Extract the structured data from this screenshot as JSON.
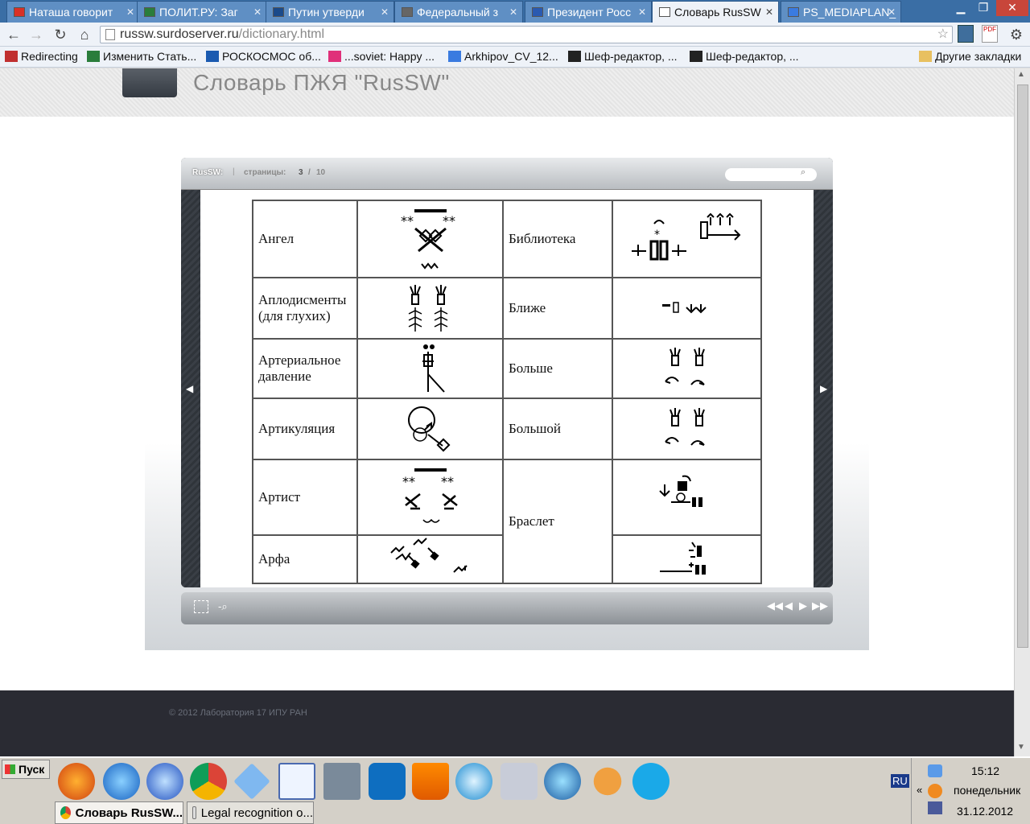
{
  "browser": {
    "tabs": [
      {
        "title": "Наташа говорит",
        "icon": "gmail-icon",
        "color": "#d93025"
      },
      {
        "title": "ПОЛИТ.РУ: Заг",
        "icon": "eye-icon",
        "color": "#2a7d3b"
      },
      {
        "title": "Путин утверди",
        "icon": "globe-icon",
        "color": "#1a4a8a"
      },
      {
        "title": "Федеральный з",
        "icon": "image-icon",
        "color": "#666"
      },
      {
        "title": "Президент Росс",
        "icon": "flag-icon",
        "color": "#2a5ab0"
      },
      {
        "title": "Словарь RusSW",
        "icon": "page-icon",
        "color": "#ffffff",
        "active": true
      },
      {
        "title": "PS_MEDIAPLAN_",
        "icon": "doc-icon",
        "color": "#3a7be0"
      }
    ],
    "url_host": "russw.surdoserver.ru",
    "url_path": "/dictionary.html",
    "bookmarks": [
      {
        "label": "Redirecting",
        "icon": "bookmark-icon",
        "color": "#c03030"
      },
      {
        "label": "Изменить Стать...",
        "icon": "eye-icon",
        "color": "#2a7d3b"
      },
      {
        "label": "РОСКОСМОС об...",
        "icon": "globe-icon",
        "color": "#1a5ab0"
      },
      {
        "label": "...soviet: Happy ...",
        "icon": "flickr-icon",
        "color": "#e0307a"
      },
      {
        "label": "Arkhipov_CV_12...",
        "icon": "doc-icon",
        "color": "#3a7be0"
      },
      {
        "label": "Шеф-редактор, ...",
        "icon": "hh-icon",
        "color": "#222"
      },
      {
        "label": "Шеф-редактор, ...",
        "icon": "hh-icon",
        "color": "#222"
      }
    ],
    "other_bookmarks": "Другие закладки"
  },
  "site": {
    "title": "Словарь ПЖЯ \"RusSW\"",
    "footer": "© 2012 Лаборатория 17 ИПУ РАН"
  },
  "viewer": {
    "brand": "RusSW:",
    "pages_label": "страницы:",
    "current_page": "3",
    "separator": "/",
    "total_pages": "10",
    "search_placeholder": ""
  },
  "dictionary": {
    "left": [
      {
        "word": "Ангел"
      },
      {
        "word": "Аплодисменты (для глухих)"
      },
      {
        "word": "Артериальное давление"
      },
      {
        "word": "Артикуляция"
      },
      {
        "word": "Артист"
      },
      {
        "word": "Арфа"
      }
    ],
    "right": [
      {
        "word": "Библиотека"
      },
      {
        "word": "Ближе"
      },
      {
        "word": "Больше"
      },
      {
        "word": "Большой"
      },
      {
        "word": "Браслет"
      }
    ]
  },
  "taskbar": {
    "start": "Пуск",
    "tasks": [
      {
        "label": "Словарь RusSW...",
        "icon": "chrome-icon"
      },
      {
        "label": "Legal recognition o...",
        "icon": "document-icon"
      }
    ],
    "lang": "RU",
    "time": "15:12",
    "weekday": "понедельник",
    "date": "31.12.2012"
  },
  "colors": {
    "accent": "#3a6ea5",
    "page_bg": "#ffffff",
    "footer_bg": "#2a2b33"
  }
}
